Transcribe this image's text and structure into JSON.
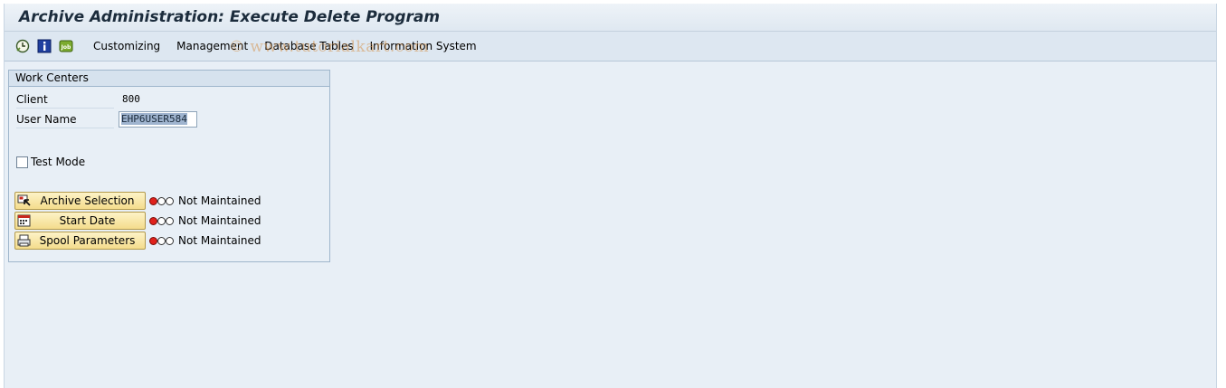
{
  "window": {
    "title": "Archive Administration: Execute Delete Program"
  },
  "toolbar": {
    "icons": [
      "execute-clock-icon",
      "info-icon",
      "job-icon"
    ],
    "job_icon_text": "Job",
    "menu": [
      "Customizing",
      "Management",
      "Database Tables",
      "Information System"
    ],
    "watermark": "© www.tutorialkart.com"
  },
  "work_centers": {
    "title": "Work Centers",
    "client_label": "Client",
    "client_value": "800",
    "user_label": "User Name",
    "user_value": "EHP6USER584",
    "test_mode_label": "Test Mode",
    "test_mode_checked": false,
    "buttons": [
      {
        "label": "Archive Selection",
        "icon": "archive-selection-icon",
        "status": "Not Maintained"
      },
      {
        "label": "Start Date",
        "icon": "calendar-icon",
        "status": "Not Maintained"
      },
      {
        "label": "Spool Parameters",
        "icon": "printer-icon",
        "status": "Not Maintained"
      }
    ]
  },
  "colors": {
    "background": "#e8eff6",
    "button": "#f4dc8c",
    "red_light": "#e0211b"
  }
}
